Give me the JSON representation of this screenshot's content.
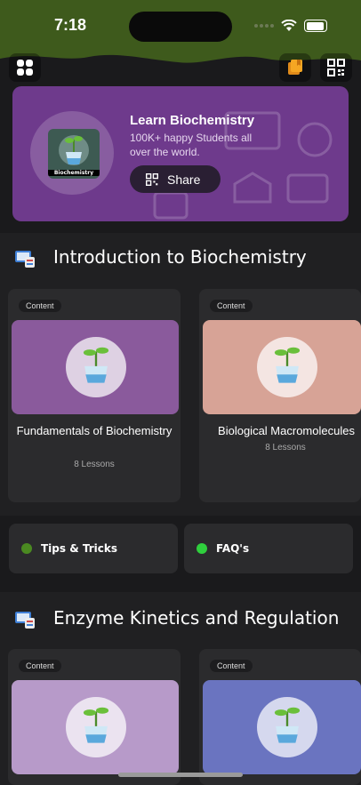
{
  "status": {
    "time": "7:18"
  },
  "topbar": {
    "left_icon": "grid-icon",
    "right_icons": [
      "bookmark-icon",
      "qr-code-icon"
    ]
  },
  "hero": {
    "logo_label": "Biochemistry",
    "title": "Learn Biochemistry",
    "subtitle": "100K+ happy Students all over the world.",
    "share_label": "Share"
  },
  "sections": [
    {
      "title": "Introduction to Biochemistry",
      "cards": [
        {
          "badge": "Content",
          "title": "Fundamentals of Biochemistry",
          "lessons": "8 Lessons",
          "color": "#8a5a9c"
        },
        {
          "badge": "Content",
          "title": "Biological Macromolecules",
          "lessons": "8 Lessons",
          "color": "#d7a396"
        }
      ]
    },
    {
      "title": "Enzyme Kinetics and Regulation",
      "cards": [
        {
          "badge": "Content",
          "color": "#b79ac9"
        },
        {
          "badge": "Content",
          "color": "#6a74c0"
        }
      ]
    }
  ],
  "quick_links": [
    {
      "label": "Tips & Tricks",
      "dot": "#4b8a21"
    },
    {
      "label": "FAQ's",
      "dot": "#2fcf3d"
    }
  ]
}
